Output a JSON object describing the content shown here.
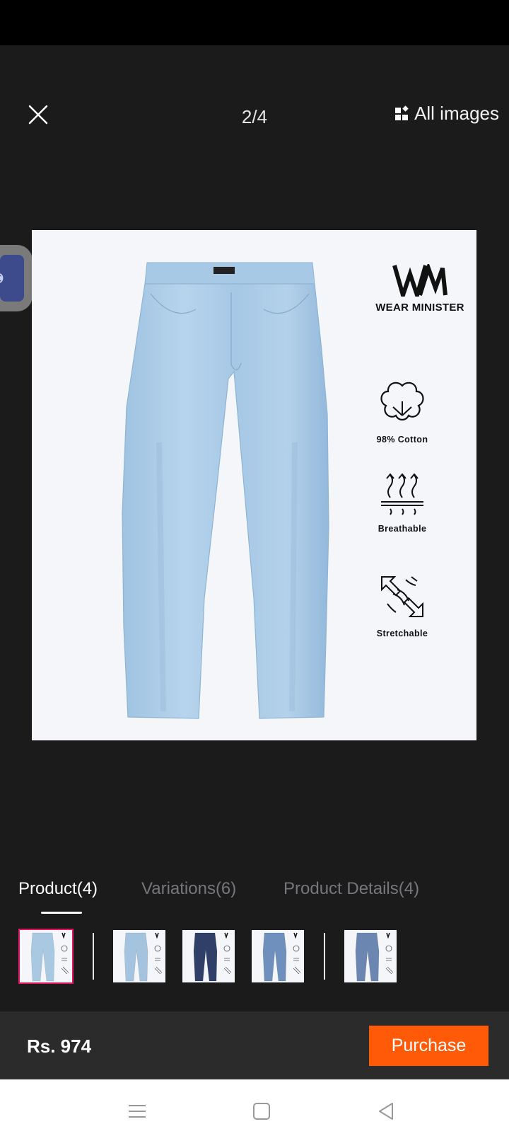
{
  "viewer": {
    "counter": "2/4",
    "all_images_label": "All images"
  },
  "product_image": {
    "brand_name": "WEAR MINISTER",
    "features": [
      "98% Cotton",
      "Breathable",
      "Stretchable"
    ]
  },
  "tabs": [
    {
      "label": "Product(4)",
      "active": true
    },
    {
      "label": "Variations(6)",
      "active": false
    },
    {
      "label": "Product Details(4)",
      "active": false
    }
  ],
  "thumbnails": [
    {
      "shade": "#a9c9e3",
      "selected": true
    },
    {
      "shade": "#a4c3df",
      "selected": false
    },
    {
      "shade": "#2f3f68",
      "selected": false
    },
    {
      "shade": "#6f8fbc",
      "selected": false
    },
    {
      "shade": "#6b86b0",
      "selected": false
    }
  ],
  "footer": {
    "price": "Rs. 974",
    "purchase_label": "Purchase"
  },
  "colors": {
    "accent": "#ff5a08",
    "selected_outline": "#e8175d",
    "denim": "#a9cbe6"
  }
}
